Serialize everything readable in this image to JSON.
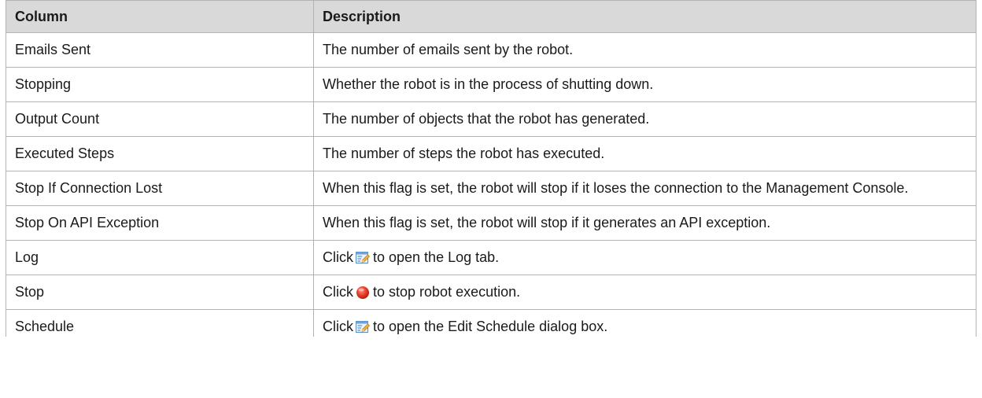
{
  "table": {
    "headers": [
      "Column",
      "Description"
    ],
    "rows": [
      {
        "column": "Emails Sent",
        "description": "The number of emails sent by the robot."
      },
      {
        "column": "Stopping",
        "description": "Whether the robot is in the process of shutting down."
      },
      {
        "column": "Output Count",
        "description": "The number of objects that the robot has generated."
      },
      {
        "column": "Executed Steps",
        "description": "The number of steps the robot has executed."
      },
      {
        "column": "Stop If Connection Lost",
        "description": "When this flag is set, the robot will stop if it loses the connection to the Management Console."
      },
      {
        "column": "Stop On API Exception",
        "description": "When this flag is set, the robot will stop if it generates an API exception."
      },
      {
        "column": "Log",
        "prefix": "Click",
        "icon": "edit-icon",
        "suffix": "to open the Log tab."
      },
      {
        "column": "Stop",
        "prefix": "Click",
        "icon": "stop-icon",
        "suffix": "to stop robot execution."
      },
      {
        "column": "Schedule",
        "prefix": "Click",
        "icon": "edit-icon",
        "suffix": "to open the Edit Schedule dialog box."
      }
    ]
  }
}
